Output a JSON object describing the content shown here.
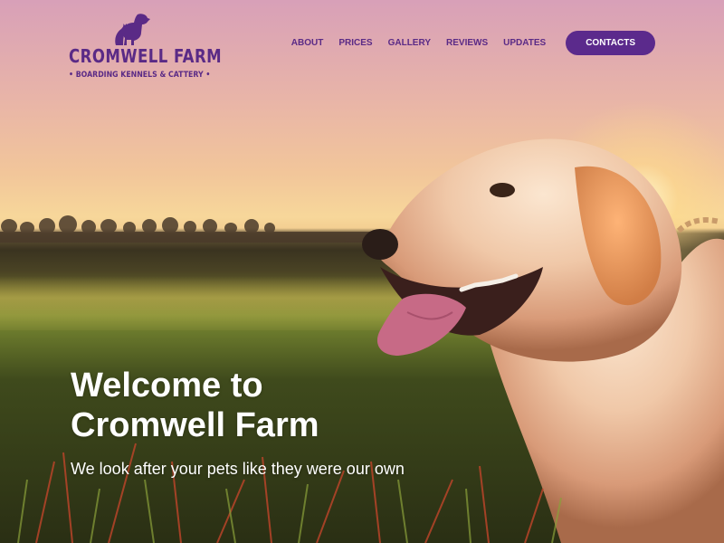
{
  "brand": {
    "name": "CROMWELL FARM",
    "tagline": "• BOARDING KENNELS & CATTERY •",
    "color": "#5a2a86"
  },
  "nav": {
    "items": [
      {
        "label": "ABOUT"
      },
      {
        "label": "PRICES"
      },
      {
        "label": "GALLERY"
      },
      {
        "label": "REVIEWS"
      },
      {
        "label": "UPDATES"
      }
    ],
    "cta_label": "CONTACTS",
    "cta_color": "#5b2a8c"
  },
  "hero": {
    "title_line1": "Welcome to",
    "title_line2": "Cromwell Farm",
    "subtitle": "We look after your pets like they were our own",
    "image_subject": "golden retriever in field at sunset"
  },
  "icons": {
    "logo": "dog-cat-silhouette-icon"
  }
}
